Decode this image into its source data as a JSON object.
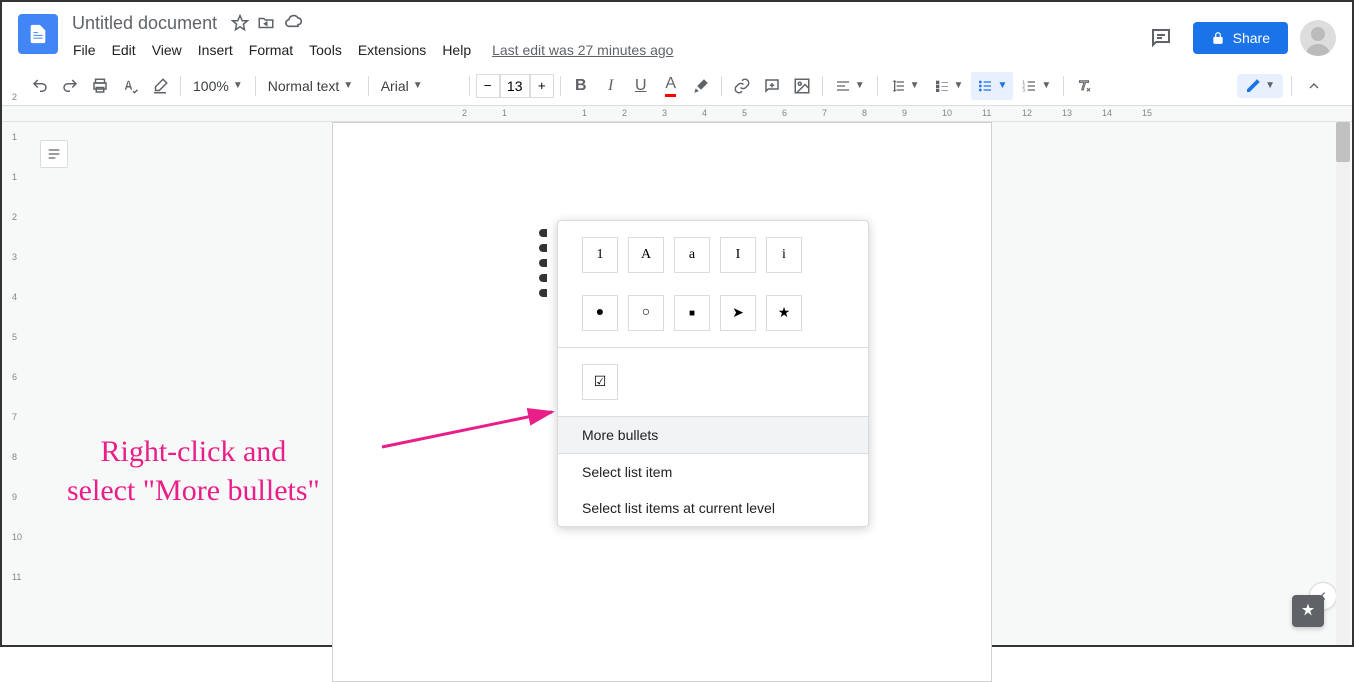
{
  "doc": {
    "title": "Untitled document",
    "last_edit": "Last edit was 27 minutes ago"
  },
  "menus": {
    "file": "File",
    "edit": "Edit",
    "view": "View",
    "insert": "Insert",
    "format": "Format",
    "tools": "Tools",
    "extensions": "Extensions",
    "help": "Help"
  },
  "header": {
    "share": "Share"
  },
  "toolbar": {
    "zoom": "100%",
    "style": "Normal text",
    "font": "Arial",
    "size": "13"
  },
  "ruler_h": [
    "2",
    "1",
    "1",
    "2",
    "3",
    "4",
    "5",
    "6",
    "7",
    "8",
    "9",
    "10",
    "11",
    "12",
    "13",
    "14",
    "15"
  ],
  "ruler_v": [
    "2",
    "1",
    "1",
    "2",
    "3",
    "4",
    "5",
    "6",
    "7",
    "8",
    "9",
    "10",
    "11"
  ],
  "context": {
    "numbered": [
      "1",
      "A",
      "a",
      "I",
      "i"
    ],
    "bullets": [
      "●",
      "○",
      "■",
      "➤",
      "★"
    ],
    "checkbox": "☑",
    "more_bullets": "More bullets",
    "select_item": "Select list item",
    "select_level": "Select list items at current level"
  },
  "annotation": {
    "line1": "Right-click and",
    "line2": "select \"More bullets\""
  }
}
